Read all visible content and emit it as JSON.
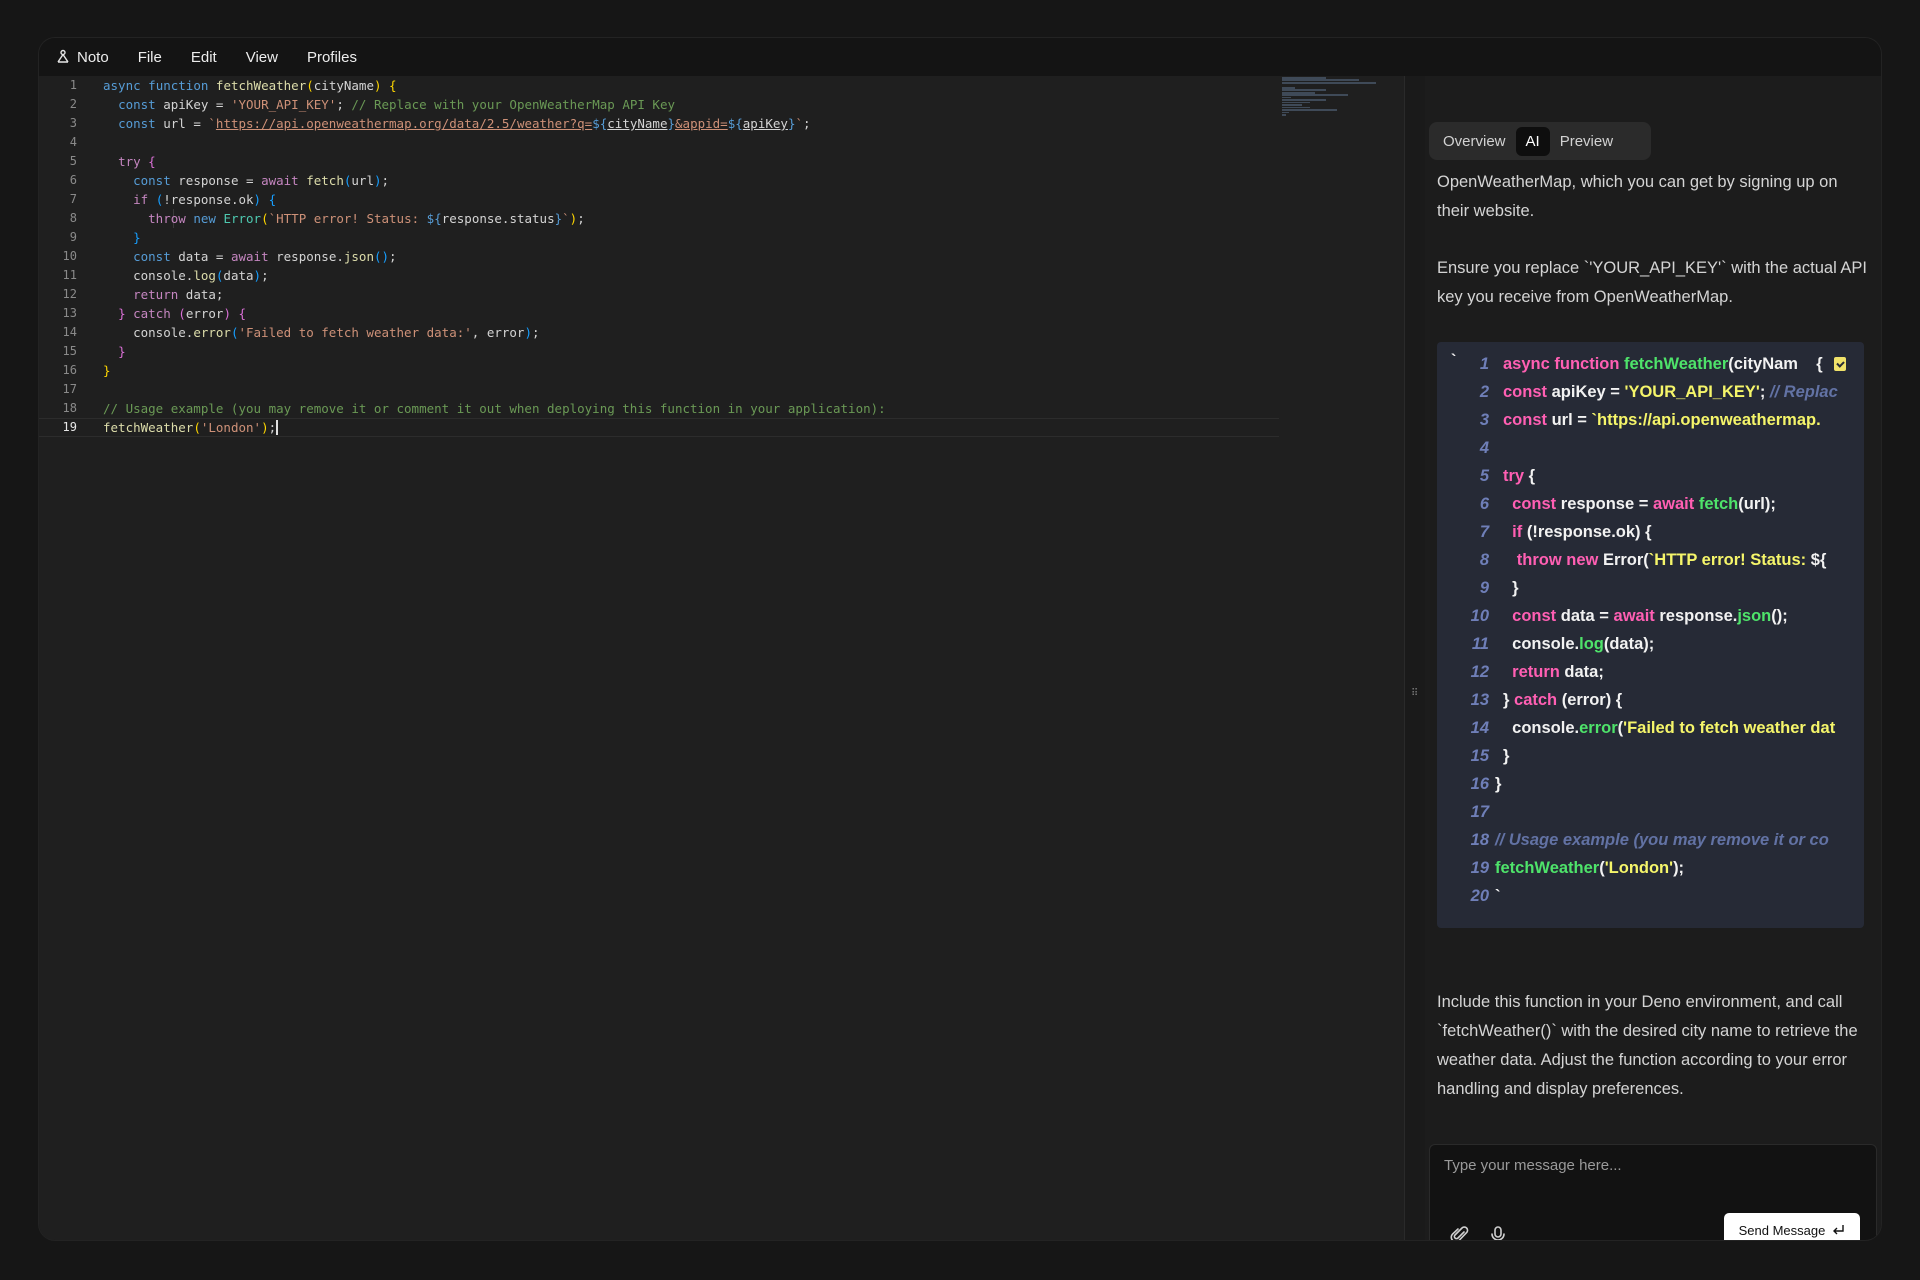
{
  "menubar": {
    "app_name": "Noto",
    "items": [
      "File",
      "Edit",
      "View",
      "Profiles"
    ]
  },
  "editor": {
    "active_line": 19,
    "line_numbers": [
      "1",
      "2",
      "3",
      "4",
      "5",
      "6",
      "7",
      "8",
      "9",
      "10",
      "11",
      "12",
      "13",
      "14",
      "15",
      "16",
      "17",
      "18",
      "19"
    ]
  },
  "panel": {
    "tabs": [
      "Overview",
      "AI",
      "Preview"
    ],
    "active_tab": "AI",
    "message_top": "OpenWeatherMap, which you can get by signing up on their website.",
    "message_key": "Ensure you replace `'YOUR_API_KEY'` with the actual API key you receive from OpenWeatherMap.",
    "message_bottom": "Include this function in your Deno environment, and call `fetchWeather()` with the desired city name to retrieve the weather data. Adjust the function according to your error handling and display preferences.",
    "code_line_numbers": [
      "1",
      "2",
      "3",
      "4",
      "5",
      "6",
      "7",
      "8",
      "9",
      "10",
      "11",
      "12",
      "13",
      "14",
      "15",
      "16",
      "17",
      "18",
      "19",
      "20"
    ],
    "composer_placeholder": "Type your message here...",
    "send_label": "Send Message"
  },
  "colors": {
    "keyword": "#569cd6",
    "string": "#ce9178",
    "comment": "#6a9955",
    "ai_keyword": "#ff5fb3",
    "ai_function": "#4ee36a",
    "ai_string": "#f5f56a"
  },
  "icons": [
    "logo-icon",
    "paperclip-icon",
    "microphone-icon",
    "enter-icon",
    "copy-icon",
    "grip-icon"
  ]
}
